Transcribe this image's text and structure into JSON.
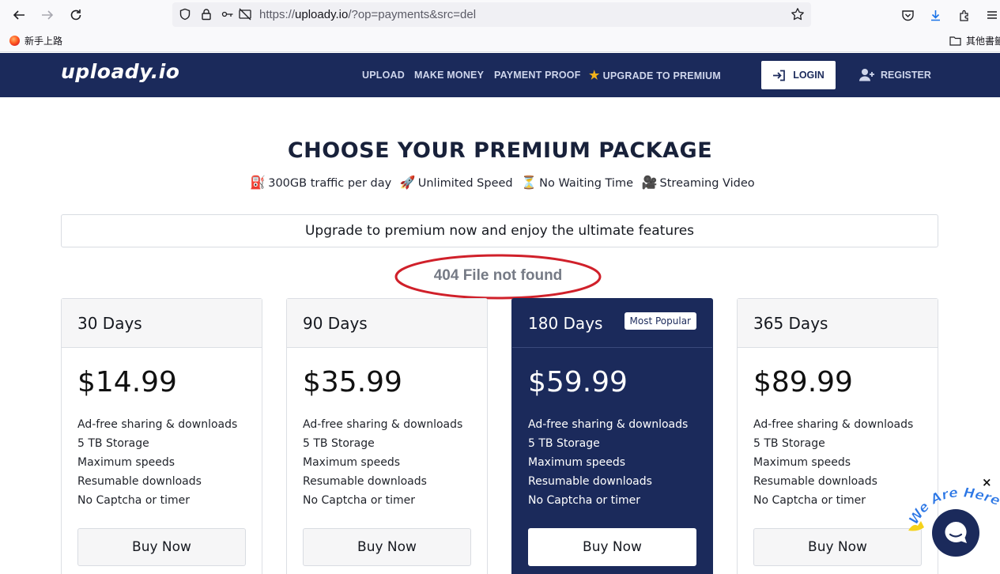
{
  "browser": {
    "url_prefix": "https://",
    "url_domain": "uploady.io",
    "url_path": "/?op=payments&src=del",
    "bookmarks": [
      {
        "label": "新手上路"
      },
      {
        "label": "其他書籤"
      }
    ]
  },
  "site": {
    "logo": "uploady.io",
    "nav": {
      "upload": "UPLOAD",
      "make_money": "MAKE MONEY",
      "payment_proof": "PAYMENT PROOF",
      "upgrade": "UPGRADE TO PREMIUM"
    },
    "login": "LOGIN",
    "register": "REGISTER"
  },
  "main": {
    "title": "CHOOSE YOUR PREMIUM PACKAGE",
    "features": [
      {
        "emoji": "⛽",
        "text": "300GB traffic per day"
      },
      {
        "emoji": "🚀",
        "text": "Unlimited Speed"
      },
      {
        "emoji": "⏳",
        "text": "No Waiting Time"
      },
      {
        "emoji": "🎥",
        "text": "Streaming Video"
      }
    ],
    "promo": "Upgrade to premium now and enjoy the ultimate features",
    "error": "404 File not found"
  },
  "plans": [
    {
      "title": "30 Days",
      "price": "$14.99",
      "buy": "Buy Now"
    },
    {
      "title": "90 Days",
      "price": "$35.99",
      "buy": "Buy Now"
    },
    {
      "title": "180 Days",
      "price": "$59.99",
      "buy": "Buy Now",
      "badge": "Most Popular"
    },
    {
      "title": "365 Days",
      "price": "$89.99",
      "buy": "Buy Now"
    }
  ],
  "plan_features": [
    "Ad-free sharing & downloads",
    "5 TB Storage",
    "Maximum speeds",
    "Resumable downloads",
    "No Captcha or timer"
  ],
  "chat": {
    "label": "We Are Here!",
    "close": "×"
  },
  "colors": {
    "brand_navy": "#1b2a5b",
    "star_gold": "#f2b21b",
    "annotation_red": "#d0202a"
  }
}
